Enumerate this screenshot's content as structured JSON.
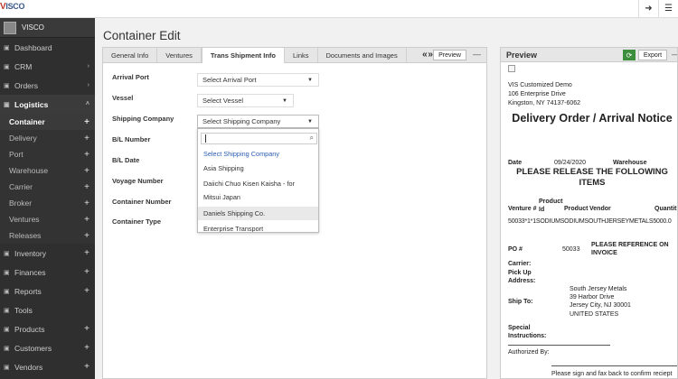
{
  "app": {
    "logo": "VISCO",
    "logo_mark": "V",
    "logo_rest": "ISCO"
  },
  "top_icons": {
    "logout": "➜",
    "menu": "☰"
  },
  "sidebar": {
    "user": "VISCO",
    "items": [
      {
        "label": "Dashboard",
        "icon": "▣"
      },
      {
        "label": "CRM",
        "icon": "▣"
      },
      {
        "label": "Orders",
        "icon": "▣"
      },
      {
        "label": "Logistics",
        "icon": "▣"
      },
      {
        "label": "Inventory",
        "icon": "▣"
      },
      {
        "label": "Finances",
        "icon": "▣"
      },
      {
        "label": "Reports",
        "icon": "▣"
      },
      {
        "label": "Tools",
        "icon": "▣"
      },
      {
        "label": "Products",
        "icon": "▣"
      },
      {
        "label": "Customers",
        "icon": "▣"
      },
      {
        "label": "Vendors",
        "icon": "▣"
      }
    ],
    "logistics_sub": [
      "Container",
      "Delivery",
      "Port",
      "Warehouse",
      "Carrier",
      "Broker",
      "Ventures",
      "Releases"
    ],
    "chevron": "›",
    "chevron_open": "˄",
    "plus": "+"
  },
  "page_title": "Container Edit",
  "tabs": [
    "General Info",
    "Ventures",
    "Trans Shipment Info",
    "Links",
    "Documents and Images"
  ],
  "tab_nav": "« »",
  "preview_button": "Preview",
  "close_glyph": "—",
  "form": {
    "labels": [
      "Arrival Port",
      "Vessel",
      "Shipping Company",
      "B/L Number",
      "B/L Date",
      "Voyage Number",
      "Container Number",
      "Container Type"
    ],
    "arrival_port": "Select Arrival Port",
    "vessel": "Select Vessel",
    "shipping_company": "Select Shipping Company",
    "arrow": "▼"
  },
  "dropdown": {
    "search_icon": "⌕",
    "options": [
      "Select Shipping Company",
      "Asia Shipping",
      "Daiichi Chuo Kisen Kaisha - for",
      "Mitsui Japan",
      "Daniels Shipping Co.",
      "Enterprise Transport"
    ],
    "highlighted_index": 4
  },
  "preview": {
    "title": "Preview",
    "refresh_icon": "⟳",
    "export": "Export",
    "doc": {
      "company": "VIS Customized Demo",
      "address1": "106 Enterprise Drive",
      "address2": "Kingston, NY 74137-6062",
      "heading": "Delivery Order / Arrival Notice",
      "date_label": "Date",
      "date_value": "09/24/2020",
      "warehouse_label": "Warehouse",
      "release_heading": "PLEASE RELEASE THE FOLLOWING ITEMS",
      "col_venture": "Venture #",
      "col_product_id_1": "Product",
      "col_product_id_2": "Id",
      "col_product": "Product",
      "col_vendor": "Vendor",
      "col_quantity": "Quantit",
      "row": "50033*1*1SODIUMSODIUMSOUTHJERSEYMETALS5000.0",
      "po_label": "PO #",
      "po_value": "50033",
      "ref_line1": "PLEASE REFERENCE ON",
      "ref_line2": "INVOICE",
      "carrier_label": "Carrier:",
      "pickup_label1": "Pick Up",
      "pickup_label2": "Address:",
      "ship_to_label": "Ship To:",
      "ship_to_1": "South Jersey Metals",
      "ship_to_2": "39 Harbor Drive",
      "ship_to_3": "Jersey City, NJ 30001",
      "ship_to_4": "UNITED STATES",
      "special_1": "Special",
      "special_2": "Instructions:",
      "authorized": "Authorized By:",
      "footer": "Please sign and fax back to confirm reciept"
    }
  }
}
